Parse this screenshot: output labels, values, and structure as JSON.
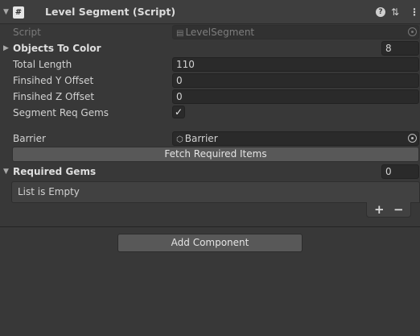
{
  "component": {
    "title": "Level Segment (Script)",
    "icons": [
      "foldout-arrow-icon",
      "script-icon",
      "help-icon",
      "preset-icon",
      "more-menu-icon"
    ]
  },
  "fields": {
    "script": {
      "label": "Script",
      "value": "LevelSegment"
    },
    "objects_to_color": {
      "label": "Objects To Color",
      "count": "8"
    },
    "total_length": {
      "label": "Total Length",
      "value": "110"
    },
    "finished_y": {
      "label": "Finsihed Y Offset",
      "value": "0"
    },
    "finished_z": {
      "label": "Finsihed Z Offset",
      "value": "0"
    },
    "segment_req_gems": {
      "label": "Segment Req Gems",
      "checked": true
    },
    "barrier": {
      "label": "Barrier",
      "value": "Barrier"
    }
  },
  "fetch_button": "Fetch Required Items",
  "required_gems": {
    "label": "Required Gems",
    "count": "0",
    "empty_text": "List is Empty",
    "add": "+",
    "remove": "−"
  },
  "add_component": "Add Component"
}
